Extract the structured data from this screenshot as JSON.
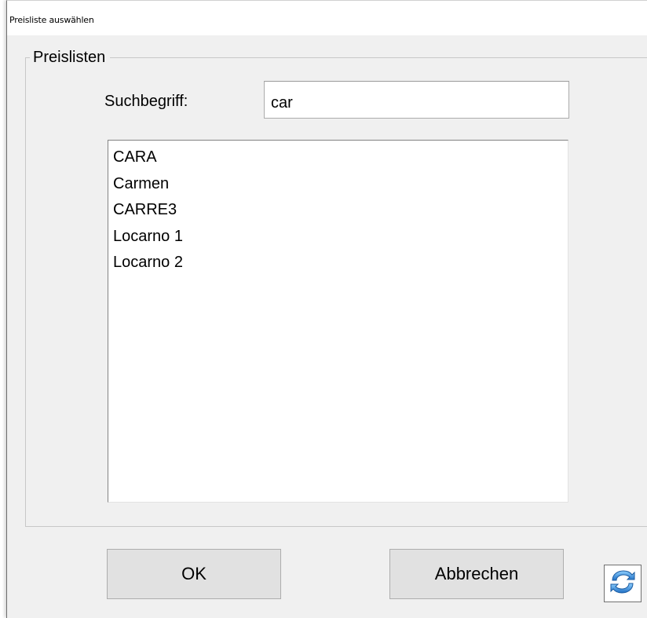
{
  "window": {
    "title": "Preisliste auswählen"
  },
  "group": {
    "legend": "Preislisten"
  },
  "search": {
    "label": "Suchbegriff:",
    "value": "car"
  },
  "list": {
    "items": [
      "CARA",
      "Carmen",
      "CARRE3",
      "Locarno 1",
      "Locarno 2"
    ]
  },
  "buttons": {
    "ok": "OK",
    "cancel": "Abbrechen"
  },
  "icons": {
    "refresh": "refresh-icon"
  },
  "colors": {
    "refresh_blue": "#2f7fd0"
  }
}
